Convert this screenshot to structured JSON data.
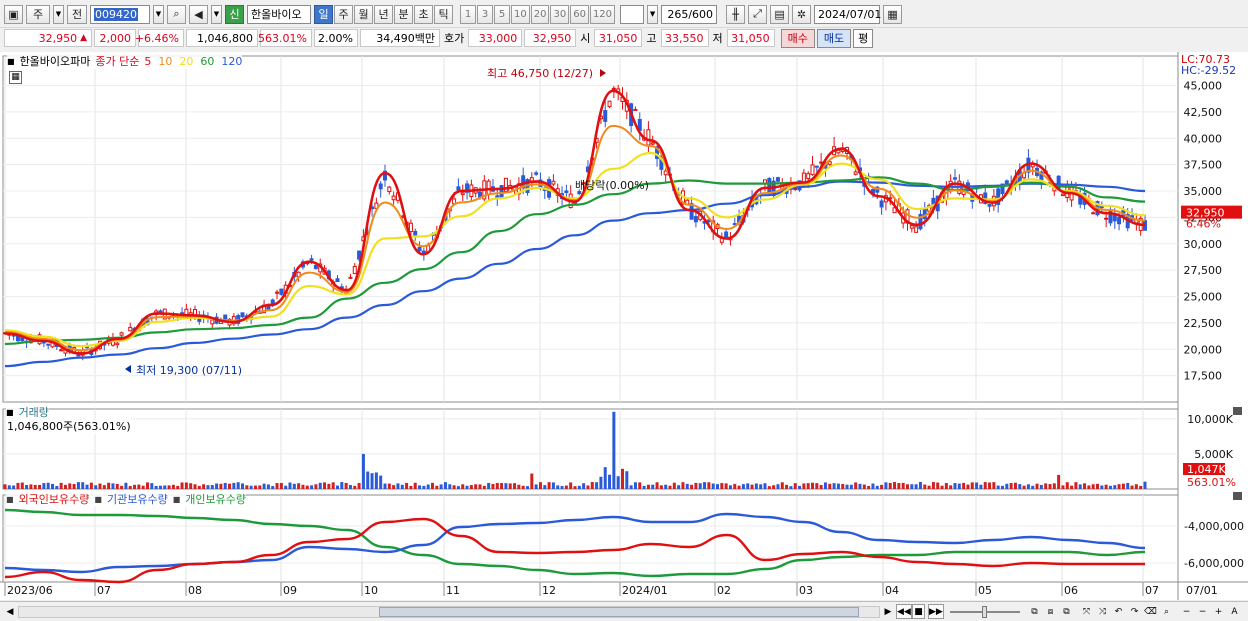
{
  "toolbar": {
    "market_label": "주",
    "period_label": "전",
    "stock_code": "009420",
    "new_badge": "신",
    "stock_name": "한올바이오",
    "periods": [
      "일",
      "주",
      "월",
      "년",
      "분",
      "초",
      "틱"
    ],
    "active_period": "일",
    "intervals": [
      "1",
      "3",
      "5",
      "10",
      "20",
      "30",
      "60",
      "120"
    ],
    "count_value": "265",
    "count_total": "/600",
    "date_value": "2024/07/01"
  },
  "quote": {
    "price": "32,950",
    "change_arrow": "▲",
    "change": "2,000",
    "change_pct": "+6.46%",
    "volume": "1,046,800",
    "volume_ratio": "563.01%",
    "turnover_pct": "2.00%",
    "amount": "34,490백만",
    "ask_label": "호가",
    "ask": "33,000",
    "bid": "32,950",
    "open_label": "시",
    "open": "31,050",
    "high_label": "고",
    "high": "33,550",
    "low_label": "저",
    "low": "31,050",
    "buy_label": "매수",
    "sell_label": "매도",
    "eval_label": "평"
  },
  "price_panel": {
    "title": "한올바이오파마",
    "ma_label": "종가 단순",
    "ma_periods": [
      {
        "label": "5",
        "color": "#e01010"
      },
      {
        "label": "10",
        "color": "#f08a1a"
      },
      {
        "label": "20",
        "color": "#f0e020"
      },
      {
        "label": "60",
        "color": "#1e9a3a"
      },
      {
        "label": "120",
        "color": "#2a5ad8"
      }
    ],
    "lc": "LC:70.73",
    "hc": "HC:-29.52",
    "high_annotation": "최고 46,750 (12/27)",
    "low_annotation": "최저 19,300 (07/11)",
    "dividend_annotation": "배당락(0.00%)",
    "last_price_tag": "32,950",
    "last_pct_tag": "6.46%",
    "y_ticks": [
      "45,000",
      "42,500",
      "40,000",
      "37,500",
      "35,000",
      "32,500",
      "30,000",
      "27,500",
      "25,000",
      "22,500",
      "20,000",
      "17,500"
    ]
  },
  "volume_panel": {
    "title": "거래량",
    "value_label": "1,046,800주(563.01%)",
    "y_ticks": [
      "10,000K",
      "5,000K"
    ],
    "last_tag": "1,047K",
    "last_pct": "563.01%"
  },
  "holdings_panel": {
    "series": [
      {
        "name": "외국인보유수량",
        "color": "#e01010"
      },
      {
        "name": "기관보유수량",
        "color": "#2a5ad8"
      },
      {
        "name": "개인보유수량",
        "color": "#1e9a3a"
      }
    ],
    "y_ticks": [
      "-4,000,000",
      "-6,000,000"
    ]
  },
  "x_axis": {
    "labels": [
      "2023/06",
      "07",
      "08",
      "09",
      "10",
      "11",
      "12",
      "2024/01",
      "02",
      "03",
      "04",
      "05",
      "06",
      "07"
    ],
    "right_label": "07/01"
  },
  "chart_data": {
    "type": "line",
    "x_range": [
      "2023/06",
      "2024/07/01"
    ],
    "price_ylim": [
      17500,
      45000
    ],
    "ma_series": [
      {
        "name": "5",
        "color": "#e01010",
        "values": [
          21500,
          20800,
          19600,
          21000,
          23400,
          23200,
          22600,
          24200,
          28300,
          25600,
          36700,
          29000,
          35000,
          35200,
          35900,
          34000,
          44500,
          39800,
          33200,
          30500,
          35300,
          35800,
          39000,
          34500,
          31800,
          35700,
          33900,
          37600,
          34800,
          32900,
          31800
        ]
      },
      {
        "name": "20",
        "color": "#f0e020",
        "values": [
          21800,
          21200,
          20300,
          20800,
          22600,
          23000,
          22700,
          23100,
          26000,
          25200,
          30500,
          30700,
          32600,
          34300,
          35300,
          34300,
          37100,
          38600,
          34300,
          32500,
          34200,
          35600,
          37600,
          36100,
          33300,
          34300,
          34200,
          36100,
          35000,
          33600,
          32700
        ]
      },
      {
        "name": "60",
        "color": "#1e9a3a",
        "values": [
          20500,
          20800,
          20900,
          21100,
          21600,
          21900,
          22000,
          22300,
          23000,
          24800,
          26300,
          27600,
          29200,
          31200,
          32800,
          33700,
          34700,
          35700,
          36000,
          35700,
          35700,
          35800,
          36000,
          36300,
          35700,
          35100,
          35400,
          35800,
          35400,
          34400,
          34000
        ]
      },
      {
        "name": "120",
        "color": "#2a5ad8",
        "values": [
          18400,
          18800,
          19200,
          19500,
          20100,
          20600,
          21000,
          21400,
          21900,
          23000,
          24200,
          25500,
          26700,
          28100,
          29500,
          30800,
          32200,
          32900,
          33200,
          33800,
          34600,
          35400,
          35900,
          35800,
          35500,
          35400,
          35500,
          35700,
          35600,
          35400,
          35000
        ]
      }
    ],
    "annotations": [
      {
        "label": "최고",
        "value": 46750,
        "date": "12/27"
      },
      {
        "label": "최저",
        "value": 19300,
        "date": "07/11"
      }
    ],
    "last_close": 32950,
    "volume_last": 1046800
  }
}
